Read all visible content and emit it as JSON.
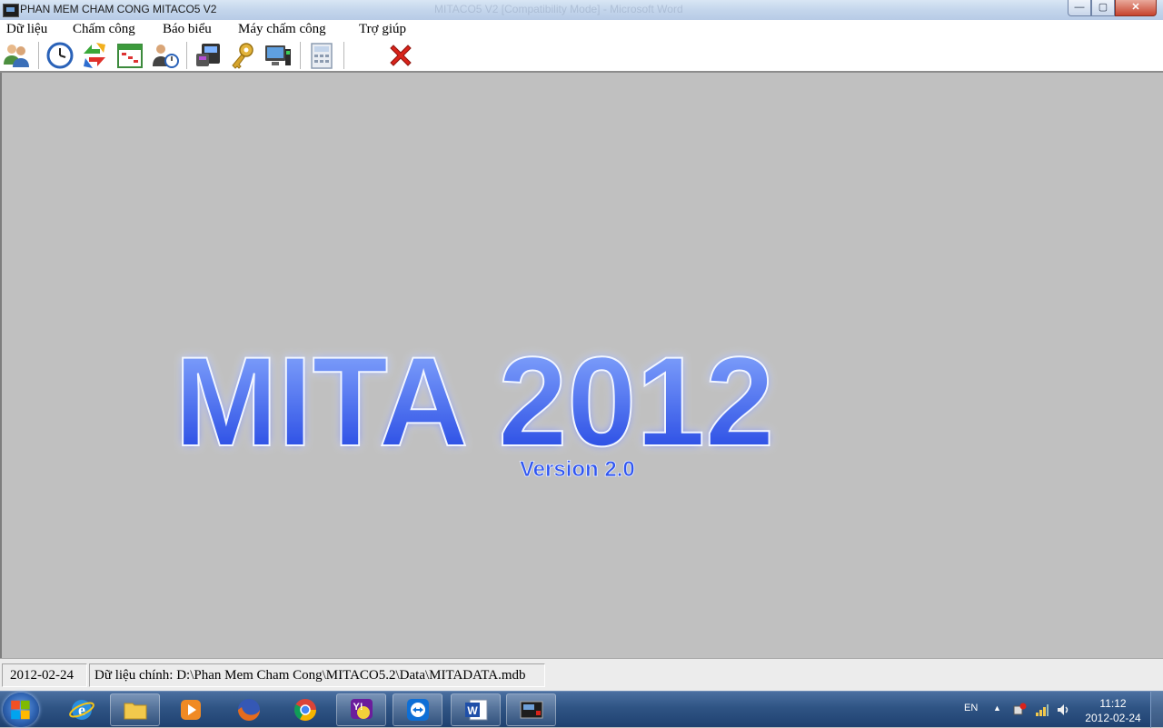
{
  "window": {
    "title": "PHAN MEM CHAM CONG MITACO5 V2",
    "ghost_title": "MITACO5 V2 [Compatibility Mode] - Microsoft Word",
    "controls": {
      "minimize": "—",
      "maximize": "▢",
      "close": "✕"
    }
  },
  "menu": [
    "Dữ liệu",
    "Chấm công",
    "Báo biểu",
    "Máy chấm công",
    "Trợ giúp"
  ],
  "toolbar": {
    "buttons": [
      {
        "icon": "employees-icon"
      },
      {
        "icon": "clock-icon"
      },
      {
        "icon": "sync-arrows-icon"
      },
      {
        "icon": "calendar-schedule-icon"
      },
      {
        "icon": "user-clock-icon"
      },
      {
        "icon": "attendance-machine-icon"
      },
      {
        "icon": "key-icon"
      },
      {
        "icon": "computer-device-icon"
      },
      {
        "icon": "calculator-icon"
      },
      {
        "icon": "exit-x-icon"
      }
    ],
    "accent_exit": "#d9231a"
  },
  "banner": {
    "title": "MITA 2012",
    "version": "Version 2.0",
    "color_top": "#7fa0ff",
    "color_bottom": "#1a3de0"
  },
  "status": {
    "date": "2012-02-24",
    "data_path": "Dữ liệu chính: D:\\Phan Mem Cham Cong\\MITACO5.2\\Data\\MITADATA.mdb"
  },
  "taskbar": {
    "apps": [
      {
        "icon": "internet-explorer-icon",
        "state": "pinned"
      },
      {
        "icon": "file-explorer-icon",
        "state": "open"
      },
      {
        "icon": "media-player-icon",
        "state": "pinned"
      },
      {
        "icon": "firefox-icon",
        "state": "pinned"
      },
      {
        "icon": "chrome-icon",
        "state": "pinned"
      },
      {
        "icon": "yahoo-messenger-icon",
        "state": "open"
      },
      {
        "icon": "teamviewer-icon",
        "state": "open"
      },
      {
        "icon": "word-icon",
        "state": "open"
      },
      {
        "icon": "mitaco-app-icon",
        "state": "open"
      }
    ],
    "language": "EN",
    "tray_arrow": "▲",
    "tray_icons": [
      "network-warning-icon",
      "signal-bars-icon",
      "volume-icon"
    ],
    "clock_time": "11:12",
    "clock_date": "2012-02-24"
  }
}
